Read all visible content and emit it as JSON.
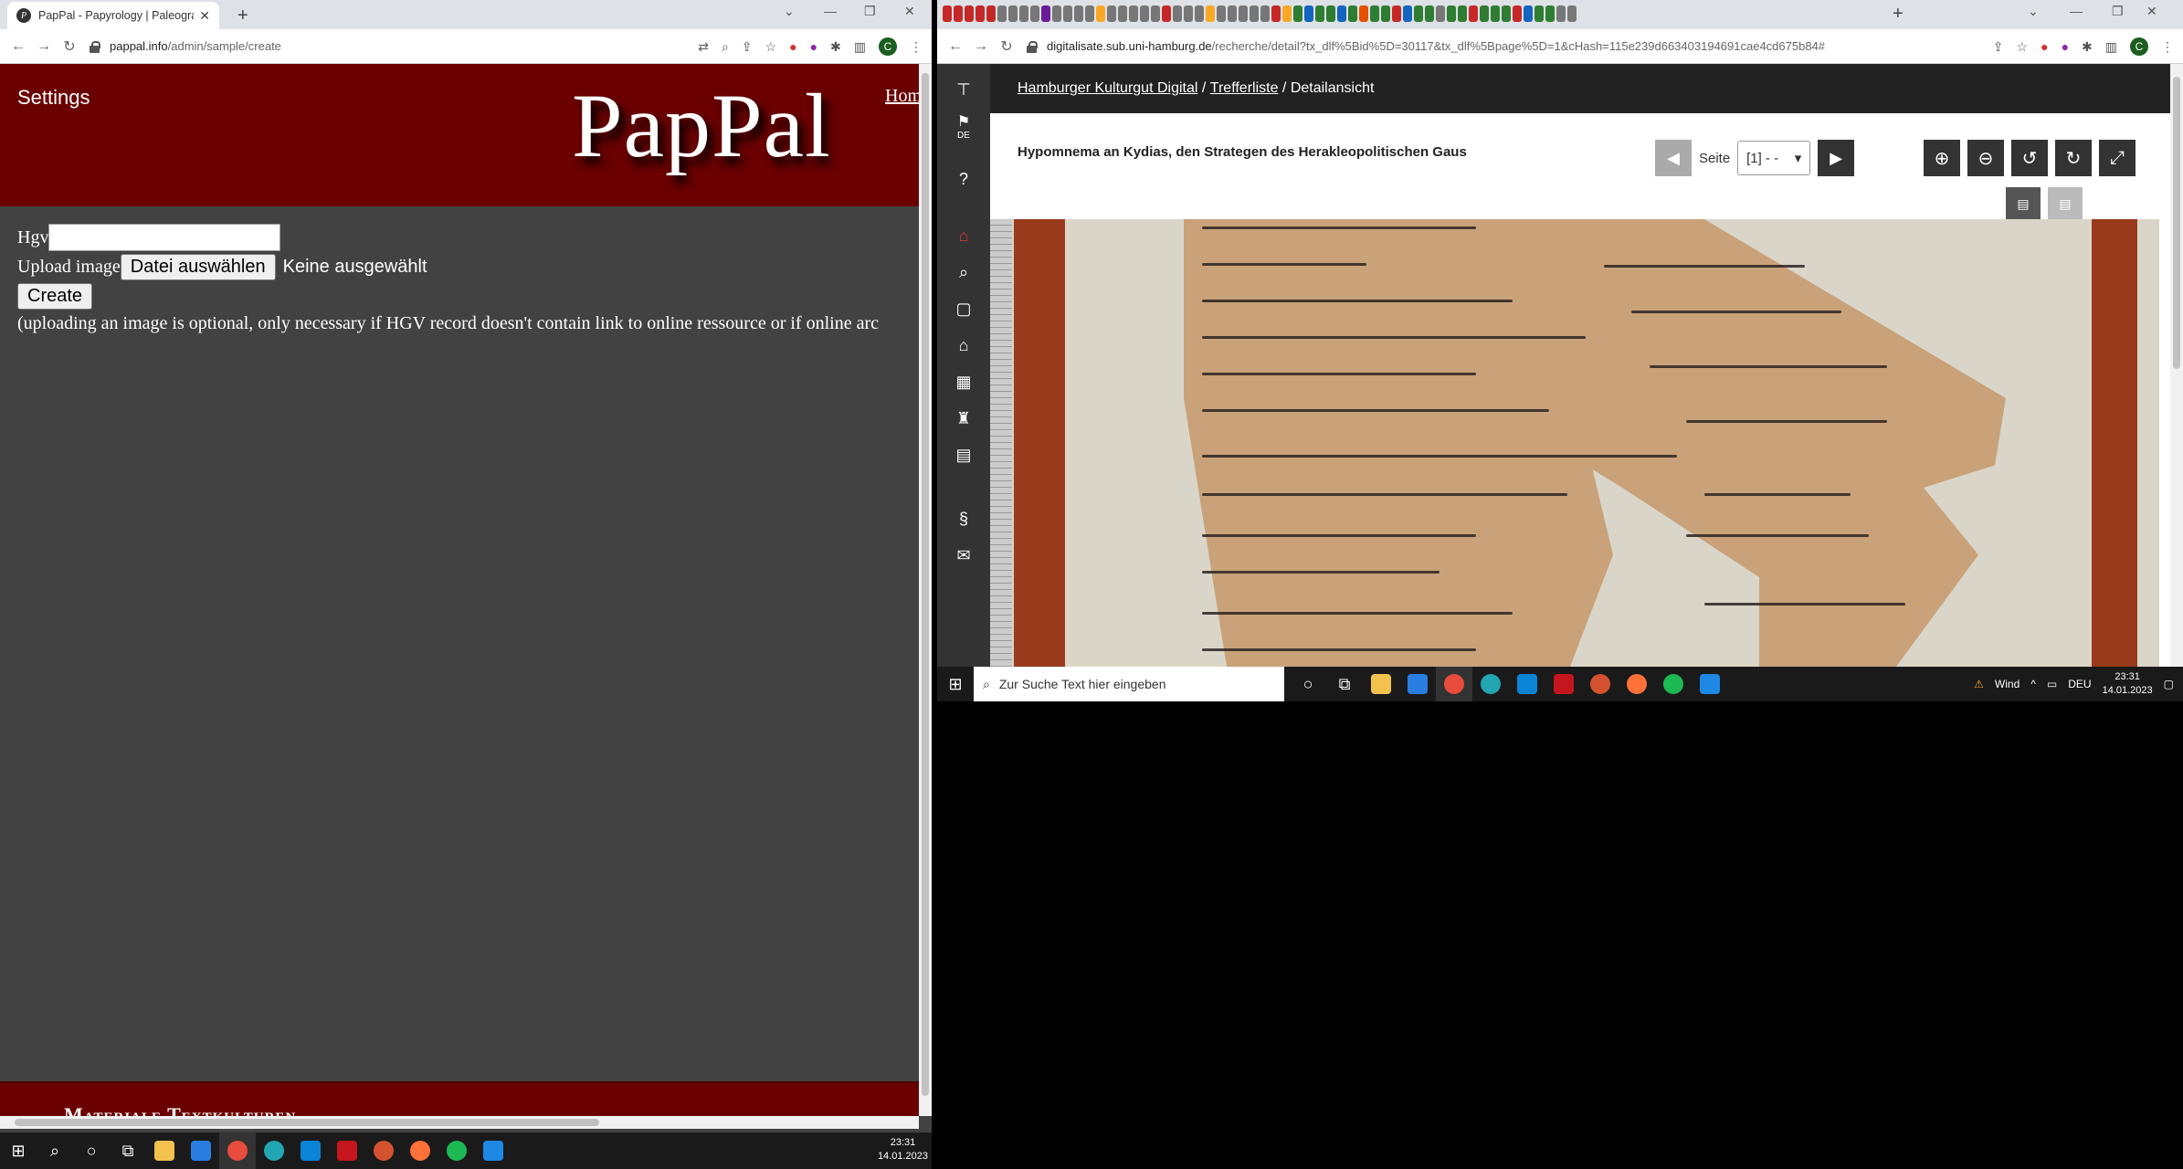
{
  "left_browser": {
    "tab_title": "PapPal - Papyrology | Paleograph",
    "tab_favicon": "P",
    "url_domain": "pappal.info",
    "url_path": "/admin/sample/create",
    "profile_initial": "C"
  },
  "pappal": {
    "settings_label": "Settings",
    "logo": "PapPal",
    "home_link": "Hom",
    "hgv_label": "Hgv",
    "hgv_value": "",
    "upload_label": "Upload image",
    "file_button": "Datei auswählen",
    "file_status": "Keine ausgewählt",
    "create_button": "Create",
    "note": "(uploading an image is optional, only necessary if HGV record doesn't contain link to online ressource or if online arc",
    "footer_text": "Materiale Textkulturen"
  },
  "left_taskbar": {
    "time": "23:31",
    "date": "14.01.2023"
  },
  "right_browser": {
    "url_domain": "digitalisate.sub.uni-hamburg.de",
    "url_path": "/recherche/detail?tx_dlf%5Bid%5D=30117&tx_dlf%5Bpage%5D=1&cHash=115e239d663403194691cae4cd675b84#",
    "profile_initial": "C"
  },
  "digitalisate": {
    "breadcrumb_home": "Hamburger Kulturgut Digital",
    "breadcrumb_sep": "/",
    "breadcrumb_list": "Trefferliste",
    "breadcrumb_current": "Detailansicht",
    "title": "Hypomnema an Kydias, den Strategen des Herakleopolitischen Gaus",
    "page_label": "Seite",
    "page_value": "[1] - -",
    "lang": "DE"
  },
  "right_taskbar": {
    "search_placeholder": "Zur Suche Text hier eingeben",
    "weather": "Wind",
    "lang": "DEU",
    "time": "23:31",
    "date": "14.01.2023"
  }
}
